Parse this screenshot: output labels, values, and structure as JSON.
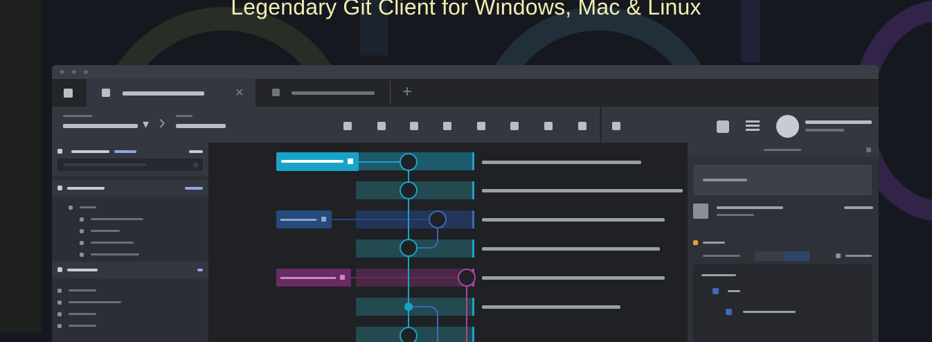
{
  "hero": {
    "title": "Legendary Git Client for Windows, Mac & Linux"
  },
  "tabs": [
    {
      "icon": "repo-tab-icon",
      "close_glyph": "✕"
    },
    {
      "icon": "repo-tab-icon"
    }
  ],
  "tabbar": {
    "new_tab_glyph": "+"
  },
  "toolbar": {
    "dropdown_glyph": "▾",
    "breadcrumb_sep_glyph": "›"
  },
  "colors": {
    "accent_cyan": "#1aa3c8",
    "blue_branch": "#3f68b8",
    "magenta_branch": "#b0439e",
    "hero_text": "#f4eeb0",
    "badge_blue": "#8fa6e6",
    "warning_orange": "#e8a23a"
  }
}
